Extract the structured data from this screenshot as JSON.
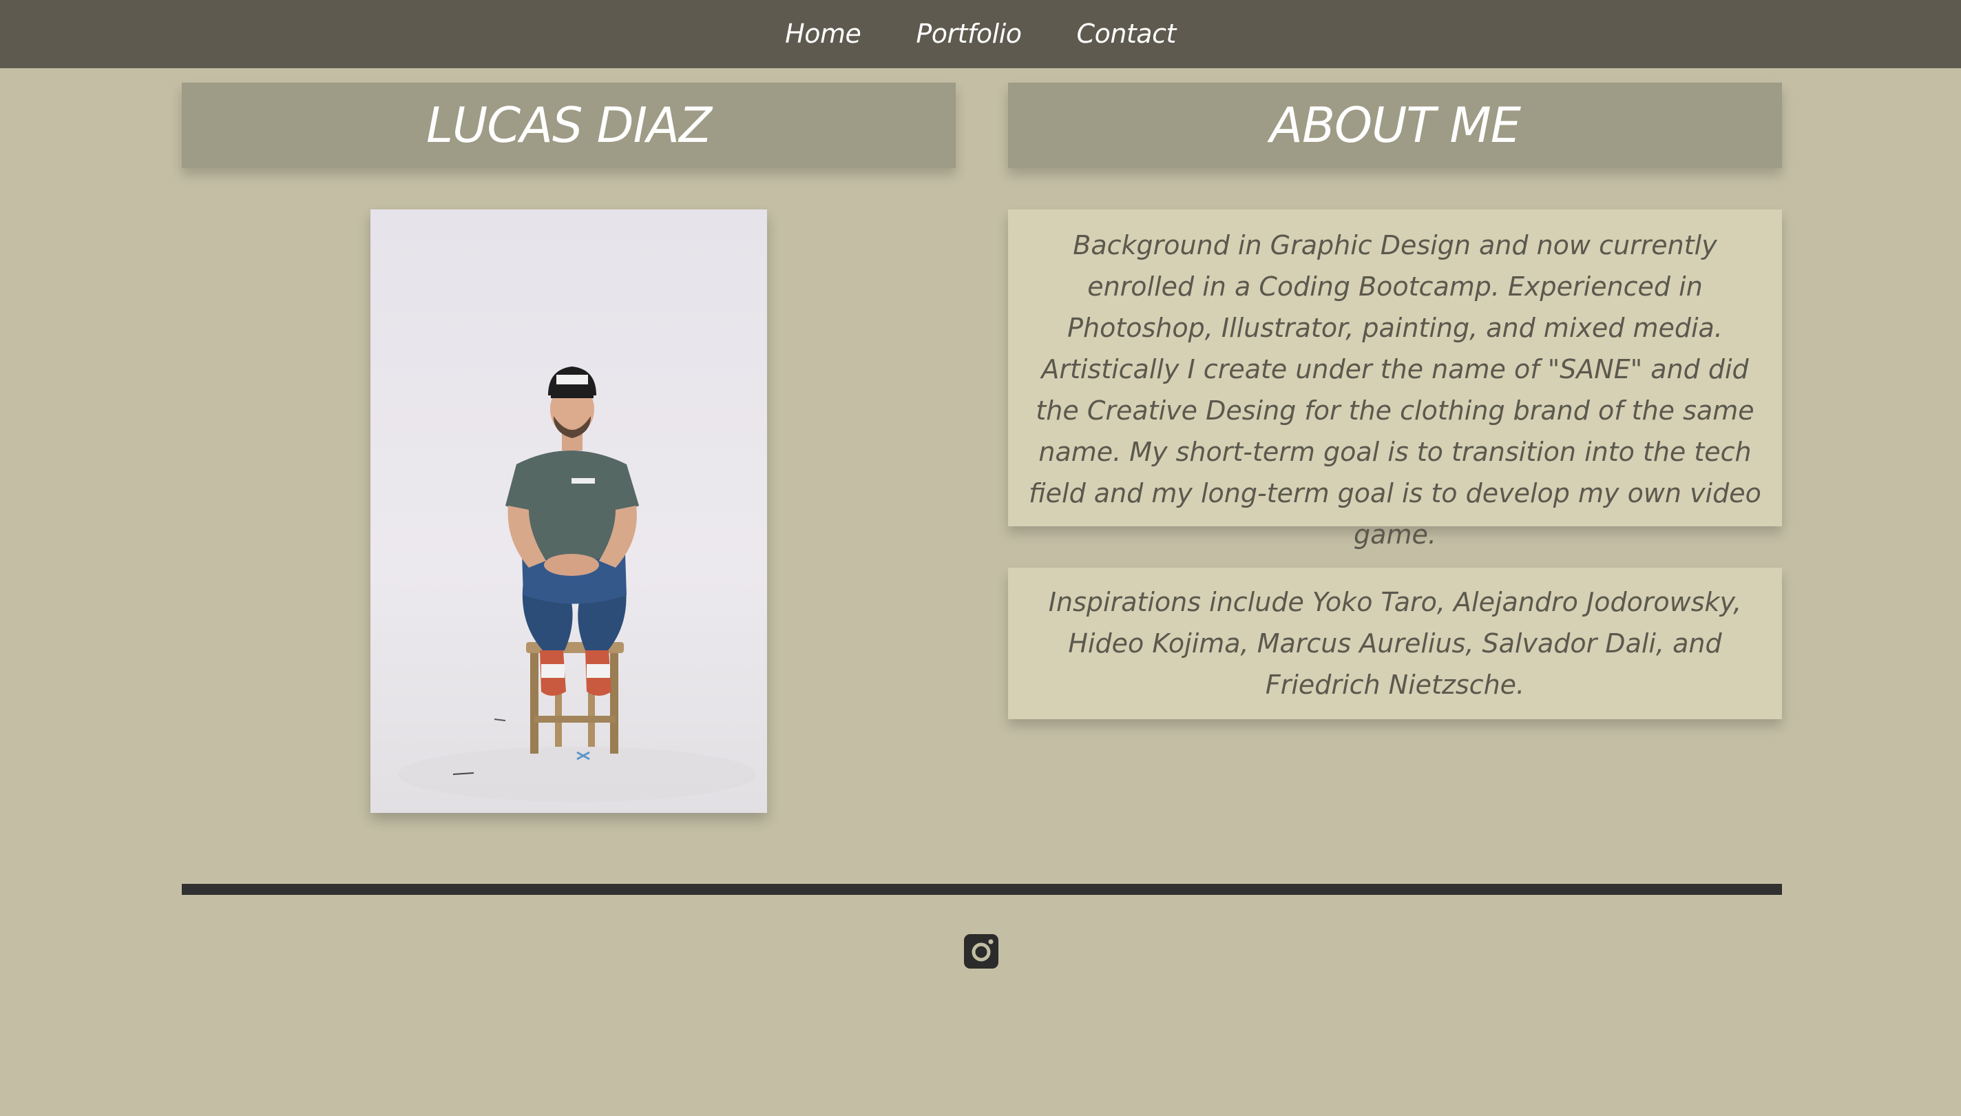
{
  "nav": {
    "items": [
      {
        "label": "Home"
      },
      {
        "label": "Portfolio"
      },
      {
        "label": "Contact"
      }
    ]
  },
  "left_panel": {
    "title": "LUCAS DIAZ"
  },
  "right_panel": {
    "title": "ABOUT ME",
    "about_text": "Background in Graphic Design and now currently enrolled in a Coding Bootcamp. Experienced in Photoshop, Illustrator, painting, and mixed media. Artistically I create under the name of \"SANE\" and did the Creative Desing for the clothing brand of the same name. My short-term goal is to transition into the tech field and my long-term goal is to develop my own video game.",
    "inspirations_text": "Inspirations include Yoko Taro, Alejandro Jodorowsky, Hideo Kojima, Marcus Aurelius, Salvador Dali, and Friedrich Nietzsche."
  },
  "footer": {
    "social_icon": "instagram-icon"
  },
  "colors": {
    "nav_bg": "#5e5a4f",
    "page_bg": "#c3bea4",
    "header_bg": "#9e9b86",
    "card_bg": "#d6d0b5",
    "divider": "#313131"
  }
}
